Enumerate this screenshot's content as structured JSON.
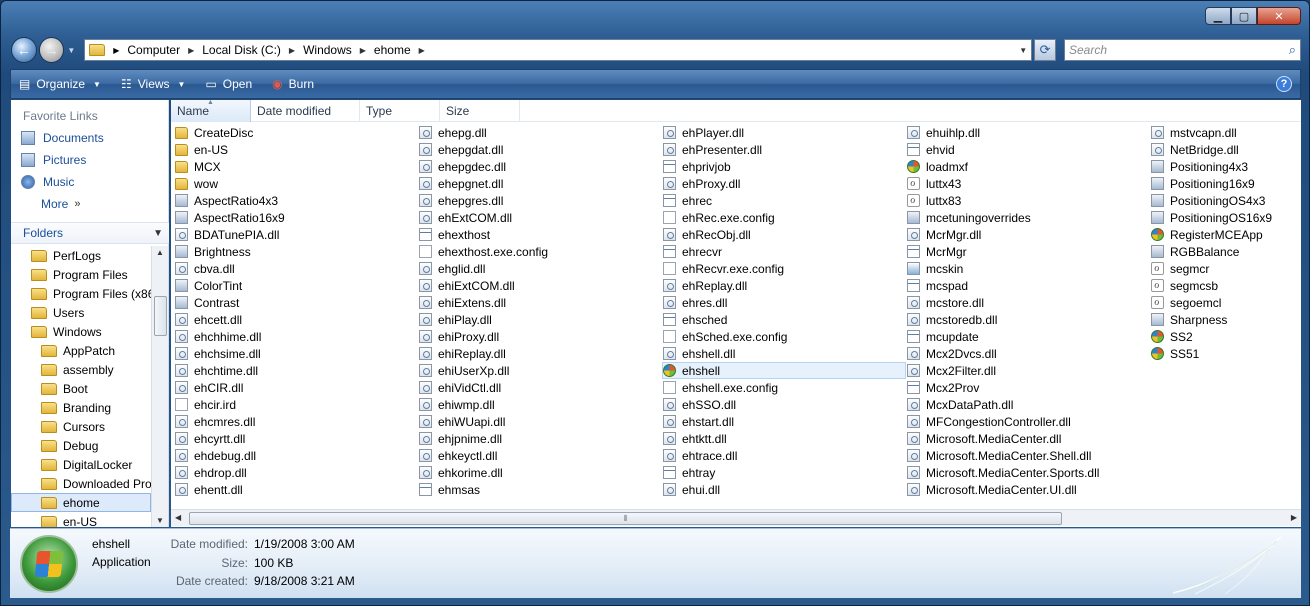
{
  "nav": {
    "breadcrumb": [
      "Computer",
      "Local Disk (C:)",
      "Windows",
      "ehome"
    ],
    "search_placeholder": "Search"
  },
  "toolbar": {
    "organize": "Organize",
    "views": "Views",
    "open": "Open",
    "burn": "Burn"
  },
  "left": {
    "favorites_title": "Favorite Links",
    "favorites": [
      "Documents",
      "Pictures",
      "Music"
    ],
    "more": "More",
    "folders_title": "Folders",
    "tree": [
      "PerfLogs",
      "Program Files",
      "Program Files (x86",
      "Users",
      "Windows",
      "AppPatch",
      "assembly",
      "Boot",
      "Branding",
      "Cursors",
      "Debug",
      "DigitalLocker",
      "Downloaded Pro",
      "ehome",
      "en-US"
    ]
  },
  "columns": [
    "Name",
    "Date modified",
    "Type",
    "Size"
  ],
  "files": {
    "col1": [
      {
        "name": "CreateDisc",
        "icon": "folder"
      },
      {
        "name": "en-US",
        "icon": "folder"
      },
      {
        "name": "MCX",
        "icon": "folder"
      },
      {
        "name": "wow",
        "icon": "folder"
      },
      {
        "name": "AspectRatio4x3",
        "icon": "cpl"
      },
      {
        "name": "AspectRatio16x9",
        "icon": "cpl"
      },
      {
        "name": "BDATunePIA.dll",
        "icon": "dll"
      },
      {
        "name": "Brightness",
        "icon": "cpl"
      },
      {
        "name": "cbva.dll",
        "icon": "dll"
      },
      {
        "name": "ColorTint",
        "icon": "cpl"
      },
      {
        "name": "Contrast",
        "icon": "cpl"
      },
      {
        "name": "ehcett.dll",
        "icon": "dll"
      },
      {
        "name": "ehchhime.dll",
        "icon": "dll"
      },
      {
        "name": "ehchsime.dll",
        "icon": "dll"
      },
      {
        "name": "ehchtime.dll",
        "icon": "dll"
      },
      {
        "name": "ehCIR.dll",
        "icon": "dll"
      },
      {
        "name": "ehcir.ird",
        "icon": "doc"
      },
      {
        "name": "ehcmres.dll",
        "icon": "dll"
      },
      {
        "name": "ehcyrtt.dll",
        "icon": "dll"
      },
      {
        "name": "ehdebug.dll",
        "icon": "dll"
      },
      {
        "name": "ehdrop.dll",
        "icon": "dll"
      },
      {
        "name": "ehentt.dll",
        "icon": "dll"
      }
    ],
    "col2": [
      {
        "name": "ehepg.dll",
        "icon": "dll"
      },
      {
        "name": "ehepgdat.dll",
        "icon": "dll"
      },
      {
        "name": "ehepgdec.dll",
        "icon": "dll"
      },
      {
        "name": "ehepgnet.dll",
        "icon": "dll"
      },
      {
        "name": "ehepgres.dll",
        "icon": "dll"
      },
      {
        "name": "ehExtCOM.dll",
        "icon": "dll"
      },
      {
        "name": "ehexthost",
        "icon": "exe"
      },
      {
        "name": "ehexthost.exe.config",
        "icon": "doc"
      },
      {
        "name": "ehglid.dll",
        "icon": "dll"
      },
      {
        "name": "ehiExtCOM.dll",
        "icon": "dll"
      },
      {
        "name": "ehiExtens.dll",
        "icon": "dll"
      },
      {
        "name": "ehiPlay.dll",
        "icon": "dll"
      },
      {
        "name": "ehiProxy.dll",
        "icon": "dll"
      },
      {
        "name": "ehiReplay.dll",
        "icon": "dll"
      },
      {
        "name": "ehiUserXp.dll",
        "icon": "dll"
      },
      {
        "name": "ehiVidCtl.dll",
        "icon": "dll"
      },
      {
        "name": "ehiwmp.dll",
        "icon": "dll"
      },
      {
        "name": "ehiWUapi.dll",
        "icon": "dll"
      },
      {
        "name": "ehjpnime.dll",
        "icon": "dll"
      },
      {
        "name": "ehkeyctl.dll",
        "icon": "dll"
      },
      {
        "name": "ehkorime.dll",
        "icon": "dll"
      },
      {
        "name": "ehmsas",
        "icon": "exe"
      }
    ],
    "col3": [
      {
        "name": "ehPlayer.dll",
        "icon": "dll"
      },
      {
        "name": "ehPresenter.dll",
        "icon": "dll"
      },
      {
        "name": "ehprivjob",
        "icon": "exe"
      },
      {
        "name": "ehProxy.dll",
        "icon": "dll"
      },
      {
        "name": "ehrec",
        "icon": "exe"
      },
      {
        "name": "ehRec.exe.config",
        "icon": "doc"
      },
      {
        "name": "ehRecObj.dll",
        "icon": "dll"
      },
      {
        "name": "ehrecvr",
        "icon": "exe"
      },
      {
        "name": "ehRecvr.exe.config",
        "icon": "doc"
      },
      {
        "name": "ehReplay.dll",
        "icon": "dll"
      },
      {
        "name": "ehres.dll",
        "icon": "dll"
      },
      {
        "name": "ehsched",
        "icon": "exe"
      },
      {
        "name": "ehSched.exe.config",
        "icon": "doc"
      },
      {
        "name": "ehshell.dll",
        "icon": "dll"
      },
      {
        "name": "ehshell",
        "icon": "mce",
        "selected": true
      },
      {
        "name": "ehshell.exe.config",
        "icon": "doc"
      },
      {
        "name": "ehSSO.dll",
        "icon": "dll"
      },
      {
        "name": "ehstart.dll",
        "icon": "dll"
      },
      {
        "name": "ehtktt.dll",
        "icon": "dll"
      },
      {
        "name": "ehtrace.dll",
        "icon": "dll"
      },
      {
        "name": "ehtray",
        "icon": "exe"
      },
      {
        "name": "ehui.dll",
        "icon": "dll"
      }
    ],
    "col4": [
      {
        "name": "ehuihlp.dll",
        "icon": "dll"
      },
      {
        "name": "ehvid",
        "icon": "exe"
      },
      {
        "name": "loadmxf",
        "icon": "mce"
      },
      {
        "name": "luttx43",
        "icon": "ax"
      },
      {
        "name": "luttx83",
        "icon": "ax"
      },
      {
        "name": "mcetuningoverrides",
        "icon": "cpl"
      },
      {
        "name": "McrMgr.dll",
        "icon": "dll"
      },
      {
        "name": "McrMgr",
        "icon": "exe"
      },
      {
        "name": "mcskin",
        "icon": "sel-img"
      },
      {
        "name": "mcspad",
        "icon": "exe"
      },
      {
        "name": "mcstore.dll",
        "icon": "dll"
      },
      {
        "name": "mcstoredb.dll",
        "icon": "dll"
      },
      {
        "name": "mcupdate",
        "icon": "exe"
      },
      {
        "name": "Mcx2Dvcs.dll",
        "icon": "dll"
      },
      {
        "name": "Mcx2Filter.dll",
        "icon": "dll"
      },
      {
        "name": "Mcx2Prov",
        "icon": "exe"
      },
      {
        "name": "McxDataPath.dll",
        "icon": "dll"
      },
      {
        "name": "MFCongestionController.dll",
        "icon": "dll"
      },
      {
        "name": "Microsoft.MediaCenter.dll",
        "icon": "dll"
      },
      {
        "name": "Microsoft.MediaCenter.Shell.dll",
        "icon": "dll"
      },
      {
        "name": "Microsoft.MediaCenter.Sports.dll",
        "icon": "dll"
      },
      {
        "name": "Microsoft.MediaCenter.UI.dll",
        "icon": "dll"
      }
    ],
    "col5": [
      {
        "name": "mstvcapn.dll",
        "icon": "dll"
      },
      {
        "name": "NetBridge.dll",
        "icon": "dll"
      },
      {
        "name": "Positioning4x3",
        "icon": "cpl"
      },
      {
        "name": "Positioning16x9",
        "icon": "cpl"
      },
      {
        "name": "PositioningOS4x3",
        "icon": "cpl"
      },
      {
        "name": "PositioningOS16x9",
        "icon": "cpl"
      },
      {
        "name": "RegisterMCEApp",
        "icon": "mce"
      },
      {
        "name": "RGBBalance",
        "icon": "cpl"
      },
      {
        "name": "segmcr",
        "icon": "ax"
      },
      {
        "name": "segmcsb",
        "icon": "ax"
      },
      {
        "name": "segoemcl",
        "icon": "ax"
      },
      {
        "name": "Sharpness",
        "icon": "cpl"
      },
      {
        "name": "SS2",
        "icon": "mce"
      },
      {
        "name": "SS51",
        "icon": "mce"
      }
    ]
  },
  "details": {
    "name": "ehshell",
    "type": "Application",
    "date_modified_label": "Date modified:",
    "date_modified": "1/19/2008 3:00 AM",
    "size_label": "Size:",
    "size": "100 KB",
    "date_created_label": "Date created:",
    "date_created": "9/18/2008 3:21 AM"
  }
}
